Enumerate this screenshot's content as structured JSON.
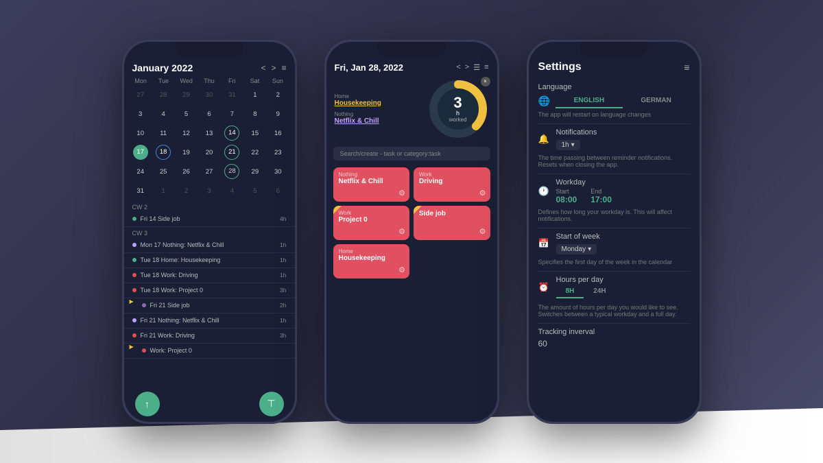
{
  "background": "#3d3d5c",
  "phone1": {
    "header": {
      "title": "January 2022",
      "prev_icon": "<",
      "next_icon": ">",
      "menu_icon": "≡"
    },
    "day_headers": [
      "Mon",
      "Tue",
      "Wed",
      "Thu",
      "Fri",
      "Sat",
      "Sun"
    ],
    "weeks": [
      [
        "27",
        "28",
        "29",
        "30",
        "31",
        "1",
        "2"
      ],
      [
        "3",
        "4",
        "5",
        "6",
        "7",
        "8",
        "9"
      ],
      [
        "10",
        "11",
        "12",
        "13",
        "14",
        "15",
        "16"
      ],
      [
        "17",
        "18",
        "19",
        "20",
        "21",
        "22",
        "23"
      ],
      [
        "24",
        "25",
        "26",
        "27",
        "28",
        "29",
        "30"
      ],
      [
        "31",
        "1",
        "2",
        "3",
        "4",
        "5",
        "6"
      ]
    ],
    "week_labels": [
      "CW 2",
      "CW 3"
    ],
    "events": [
      {
        "week": "CW 2",
        "label": "Fri 14  Side job",
        "time": "4h",
        "dot": "green"
      },
      {
        "week": "CW 3",
        "label": "Mon 17  Nothing: Netflix & Chill",
        "time": "1h",
        "dot": "purple"
      },
      {
        "label": "Tue 18  Home: Housekeeping",
        "time": "1h",
        "dot": "green"
      },
      {
        "label": "Tue 18  Work: Driving",
        "time": "1h",
        "dot": "red"
      },
      {
        "label": "Tue 18  Work: Project 0",
        "time": "3h",
        "dot": "red"
      },
      {
        "label": "Fri 21  Side job",
        "time": "2h",
        "dot": "yellow"
      },
      {
        "label": "Fri 21  Nothing: Netflix & Chill",
        "time": "1h",
        "dot": "purple"
      },
      {
        "label": "Fri 21  Work: Driving",
        "time": "3h",
        "dot": "red"
      },
      {
        "label": "Work: Project 0",
        "time": "",
        "dot": "red"
      }
    ],
    "bottom_buttons": {
      "share": "↑",
      "filter": "⊤"
    }
  },
  "phone2": {
    "header": {
      "title": "Fri, Jan 28, 2022",
      "prev_icon": "<",
      "next_icon": ">",
      "cal_icon": "📅",
      "menu_icon": "≡"
    },
    "tracker": {
      "category1": "Home",
      "task1": "Housekeeping",
      "category2": "Nothing",
      "task2": "Netflix & Chill",
      "hours": "3",
      "hours_unit": "h",
      "worked_label": "worked",
      "donut_color": "#f0c040",
      "donut_bg": "#2a3a4a",
      "donut_pct": 37
    },
    "search_placeholder": "Search/create - task or category:task",
    "tasks": [
      {
        "category": "Nothing",
        "name": "Netflix & Chill",
        "has_flag": false
      },
      {
        "category": "Work",
        "name": "Driving",
        "has_flag": false
      },
      {
        "category": "Work",
        "name": "Project 0",
        "has_flag": true
      },
      {
        "category": "",
        "name": "Side job",
        "has_flag": true
      },
      {
        "category": "Home",
        "name": "Housekeeping",
        "has_flag": false
      }
    ]
  },
  "phone3": {
    "header": {
      "title": "Settings",
      "menu_icon": "≡"
    },
    "language": {
      "label": "Language",
      "english": "ENGLISH",
      "german": "GERMAN",
      "active": "english",
      "restart_note": "The app will restart on language changes"
    },
    "notifications": {
      "label": "Notifications",
      "value": "1h",
      "desc": "The time passing between reminder notifications. Resets when closing the app."
    },
    "workday": {
      "label": "Workday",
      "start_label": "Start",
      "end_label": "End",
      "start": "08:00",
      "end": "17:00",
      "desc": "Defines how long your workday is. This will affect notifications."
    },
    "start_of_week": {
      "label": "Start of week",
      "value": "Monday",
      "desc": "Specifies the first day of the week in the calendar"
    },
    "hours_per_day": {
      "label": "Hours per day",
      "option1": "8H",
      "option2": "24H",
      "active": "8H",
      "desc": "The amount of hours per day you would like to see. Switches between a typical workday and a full day."
    },
    "tracking_interval": {
      "label": "Tracking inverval",
      "value": "60"
    }
  }
}
